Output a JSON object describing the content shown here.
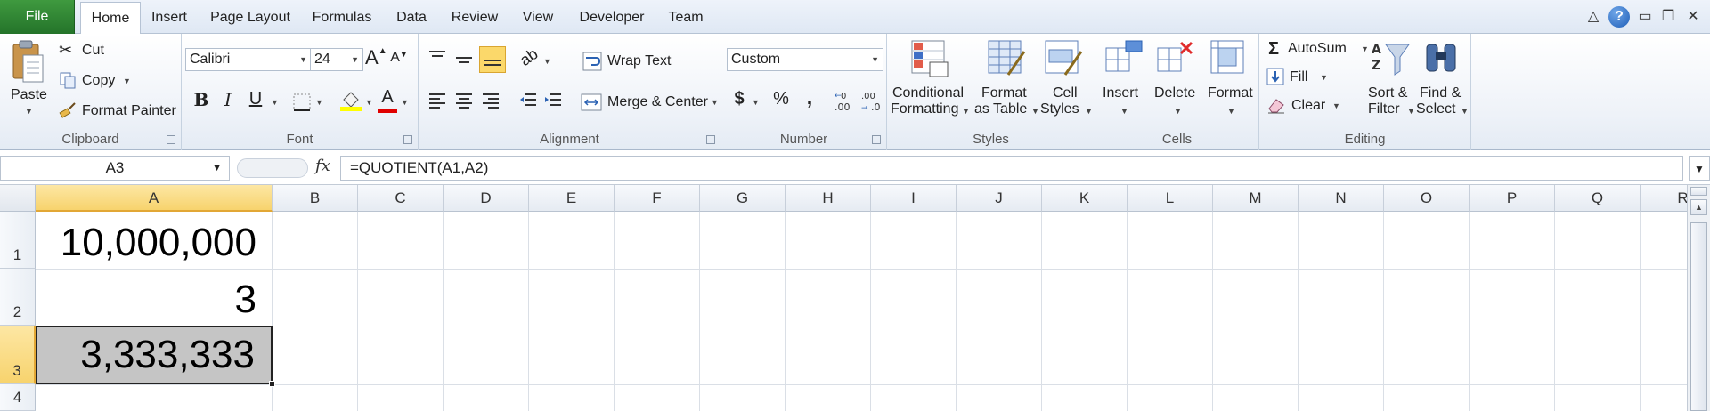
{
  "tabs": {
    "file": "File",
    "home": "Home",
    "insert": "Insert",
    "page_layout": "Page Layout",
    "formulas": "Formulas",
    "data": "Data",
    "review": "Review",
    "view": "View",
    "developer": "Developer",
    "team": "Team"
  },
  "window": {
    "help": "?",
    "minimize": "▭",
    "restore": "❐",
    "close": "✕",
    "collapse": "△"
  },
  "clipboard": {
    "label": "Clipboard",
    "paste": "Paste",
    "cut": "Cut",
    "copy": "Copy",
    "format_painter": "Format Painter"
  },
  "font": {
    "label": "Font",
    "family": "Calibri",
    "size": "24",
    "grow": "A",
    "shrink": "A",
    "bold": "B",
    "italic": "I",
    "underline": "U",
    "font_color": "A"
  },
  "alignment": {
    "label": "Alignment",
    "wrap_text": "Wrap Text",
    "merge_center": "Merge & Center"
  },
  "number": {
    "label": "Number",
    "format": "Custom",
    "currency": "$",
    "percent": "%",
    "comma": ","
  },
  "styles": {
    "label": "Styles",
    "conditional_1": "Conditional",
    "conditional_2": "Formatting",
    "format_table_1": "Format",
    "format_table_2": "as Table",
    "cell_styles_1": "Cell",
    "cell_styles_2": "Styles"
  },
  "cells": {
    "label": "Cells",
    "insert": "Insert",
    "delete": "Delete",
    "format": "Format"
  },
  "editing": {
    "label": "Editing",
    "autosum": "AutoSum",
    "fill": "Fill",
    "clear": "Clear",
    "sort_1": "Sort &",
    "sort_2": "Filter",
    "find_1": "Find &",
    "find_2": "Select"
  },
  "formula_bar": {
    "name_box": "A3",
    "fx": "fx",
    "formula": "=QUOTIENT(A1,A2)"
  },
  "grid": {
    "columns": [
      "A",
      "B",
      "C",
      "D",
      "E",
      "F",
      "G",
      "H",
      "I",
      "J",
      "K",
      "L",
      "M",
      "N",
      "O",
      "P",
      "Q",
      "R"
    ],
    "rows": [
      "1",
      "2",
      "3",
      "4"
    ],
    "selected_cell": "A3",
    "cells": {
      "A1": "10,000,000",
      "A2": "3",
      "A3": "3,333,333"
    }
  },
  "colors": {
    "file_tab": "#2e7d32",
    "selection_header": "#f7d36d",
    "selected_cell_fill": "#c5c5c5",
    "font_color_bar": "#e00000",
    "highlight_bar": "#ffff00"
  }
}
